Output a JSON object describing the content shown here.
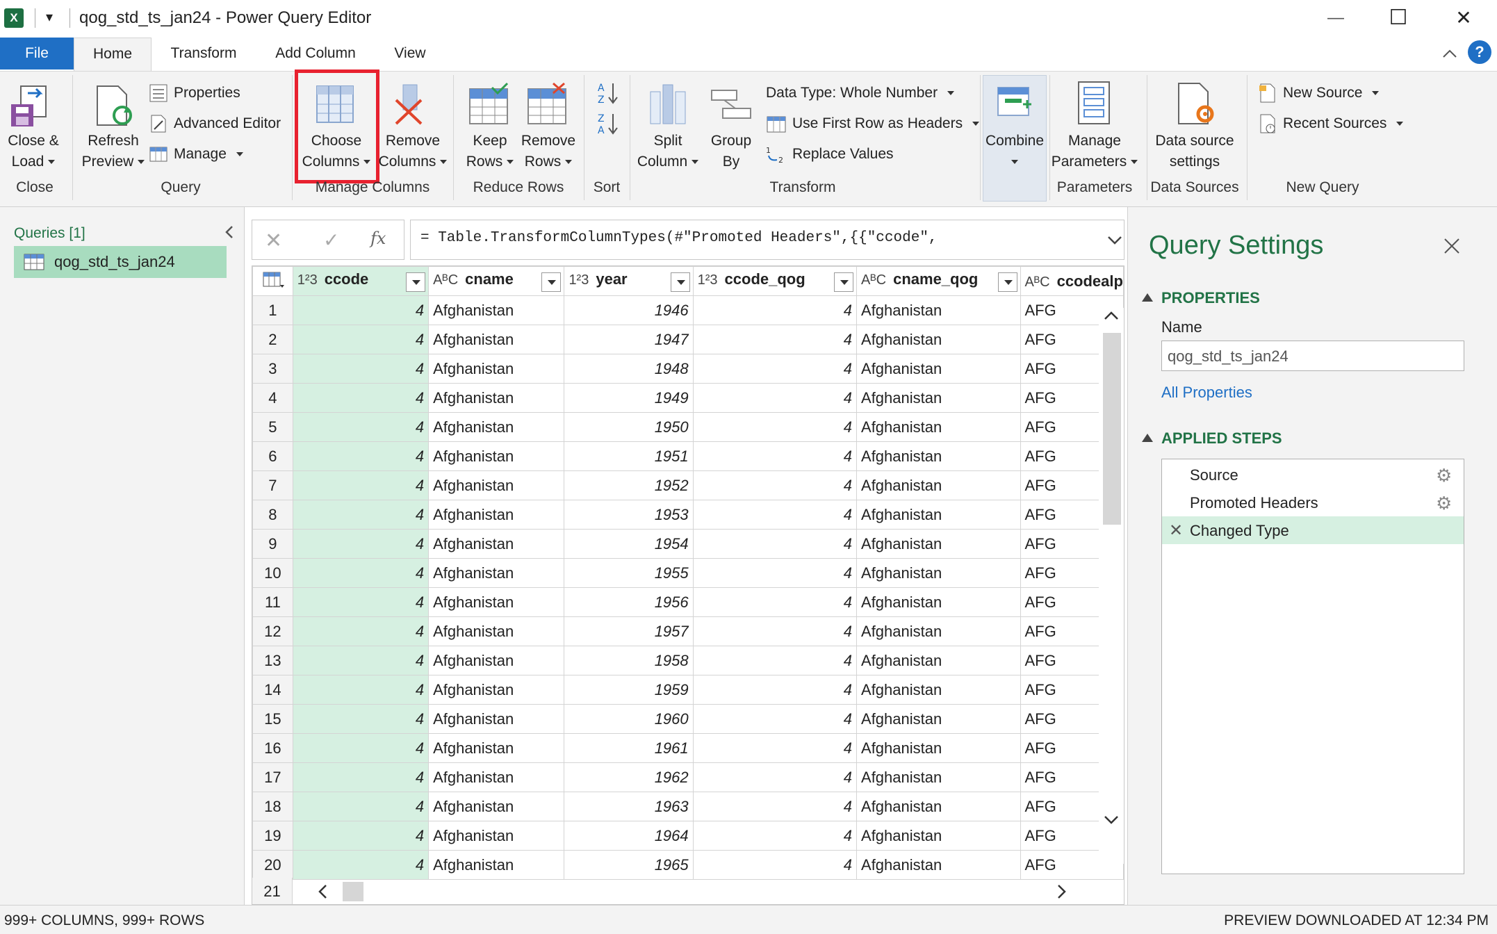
{
  "window": {
    "title": "qog_std_ts_jan24 - Power Query Editor",
    "quick_access_arrow": "▾",
    "minimize": "—",
    "maximize": "☐",
    "close": "✕"
  },
  "tabs": {
    "file": "File",
    "home": "Home",
    "transform": "Transform",
    "add_column": "Add Column",
    "view": "View"
  },
  "ribbon": {
    "close_load": {
      "line1": "Close &",
      "line2": "Load"
    },
    "refresh_preview": {
      "line1": "Refresh",
      "line2": "Preview"
    },
    "properties": "Properties",
    "advanced_editor": "Advanced Editor",
    "manage": "Manage",
    "choose_columns": {
      "line1": "Choose",
      "line2": "Columns"
    },
    "remove_columns": {
      "line1": "Remove",
      "line2": "Columns"
    },
    "keep_rows": {
      "line1": "Keep",
      "line2": "Rows"
    },
    "remove_rows": {
      "line1": "Remove",
      "line2": "Rows"
    },
    "split_column": {
      "line1": "Split",
      "line2": "Column"
    },
    "group_by": {
      "line1": "Group",
      "line2": "By"
    },
    "data_type": "Data Type: Whole Number",
    "use_first_row": "Use First Row as Headers",
    "replace_values": "Replace Values",
    "combine": "Combine",
    "manage_parameters": {
      "line1": "Manage",
      "line2": "Parameters"
    },
    "data_source_settings": {
      "line1": "Data source",
      "line2": "settings"
    },
    "new_source": "New Source",
    "recent_sources": "Recent Sources",
    "groups": {
      "close": "Close",
      "query": "Query",
      "manage_columns": "Manage Columns",
      "reduce_rows": "Reduce Rows",
      "sort": "Sort",
      "transform": "Transform",
      "parameters": "Parameters",
      "data_sources": "Data Sources",
      "new_query": "New Query"
    },
    "highlight_color": "#e8212f"
  },
  "queries": {
    "header": "Queries [1]",
    "items": [
      "qog_std_ts_jan24"
    ]
  },
  "formula": {
    "fx": "fx",
    "text": "= Table.TransformColumnTypes(#\"Promoted Headers\",{{\"ccode\","
  },
  "grid": {
    "columns": [
      {
        "type": "1²3",
        "name": "ccode"
      },
      {
        "type": "AᴮC",
        "name": "cname"
      },
      {
        "type": "1²3",
        "name": "year"
      },
      {
        "type": "1²3",
        "name": "ccode_qog"
      },
      {
        "type": "AᴮC",
        "name": "cname_qog"
      },
      {
        "type": "AᴮC",
        "name": "ccodealp"
      }
    ],
    "rows": [
      [
        "1",
        "4",
        "Afghanistan",
        "1946",
        "4",
        "Afghanistan",
        "AFG"
      ],
      [
        "2",
        "4",
        "Afghanistan",
        "1947",
        "4",
        "Afghanistan",
        "AFG"
      ],
      [
        "3",
        "4",
        "Afghanistan",
        "1948",
        "4",
        "Afghanistan",
        "AFG"
      ],
      [
        "4",
        "4",
        "Afghanistan",
        "1949",
        "4",
        "Afghanistan",
        "AFG"
      ],
      [
        "5",
        "4",
        "Afghanistan",
        "1950",
        "4",
        "Afghanistan",
        "AFG"
      ],
      [
        "6",
        "4",
        "Afghanistan",
        "1951",
        "4",
        "Afghanistan",
        "AFG"
      ],
      [
        "7",
        "4",
        "Afghanistan",
        "1952",
        "4",
        "Afghanistan",
        "AFG"
      ],
      [
        "8",
        "4",
        "Afghanistan",
        "1953",
        "4",
        "Afghanistan",
        "AFG"
      ],
      [
        "9",
        "4",
        "Afghanistan",
        "1954",
        "4",
        "Afghanistan",
        "AFG"
      ],
      [
        "10",
        "4",
        "Afghanistan",
        "1955",
        "4",
        "Afghanistan",
        "AFG"
      ],
      [
        "11",
        "4",
        "Afghanistan",
        "1956",
        "4",
        "Afghanistan",
        "AFG"
      ],
      [
        "12",
        "4",
        "Afghanistan",
        "1957",
        "4",
        "Afghanistan",
        "AFG"
      ],
      [
        "13",
        "4",
        "Afghanistan",
        "1958",
        "4",
        "Afghanistan",
        "AFG"
      ],
      [
        "14",
        "4",
        "Afghanistan",
        "1959",
        "4",
        "Afghanistan",
        "AFG"
      ],
      [
        "15",
        "4",
        "Afghanistan",
        "1960",
        "4",
        "Afghanistan",
        "AFG"
      ],
      [
        "16",
        "4",
        "Afghanistan",
        "1961",
        "4",
        "Afghanistan",
        "AFG"
      ],
      [
        "17",
        "4",
        "Afghanistan",
        "1962",
        "4",
        "Afghanistan",
        "AFG"
      ],
      [
        "18",
        "4",
        "Afghanistan",
        "1963",
        "4",
        "Afghanistan",
        "AFG"
      ],
      [
        "19",
        "4",
        "Afghanistan",
        "1964",
        "4",
        "Afghanistan",
        "AFG"
      ],
      [
        "20",
        "4",
        "Afghanistan",
        "1965",
        "4",
        "Afghanistan",
        "AFG"
      ]
    ],
    "last_row_number": "21"
  },
  "settings": {
    "title": "Query Settings",
    "properties_header": "PROPERTIES",
    "name_label": "Name",
    "name_value": "qog_std_ts_jan24",
    "all_properties": "All Properties",
    "applied_steps_header": "APPLIED STEPS",
    "steps": [
      "Source",
      "Promoted Headers",
      "Changed Type"
    ]
  },
  "status": {
    "left": "999+ COLUMNS, 999+ ROWS",
    "right": "PREVIEW DOWNLOADED AT 12:34 PM"
  },
  "colors": {
    "accent_green": "#217346",
    "selected_green": "#a8dcbf",
    "link_blue": "#1f6fc5"
  }
}
